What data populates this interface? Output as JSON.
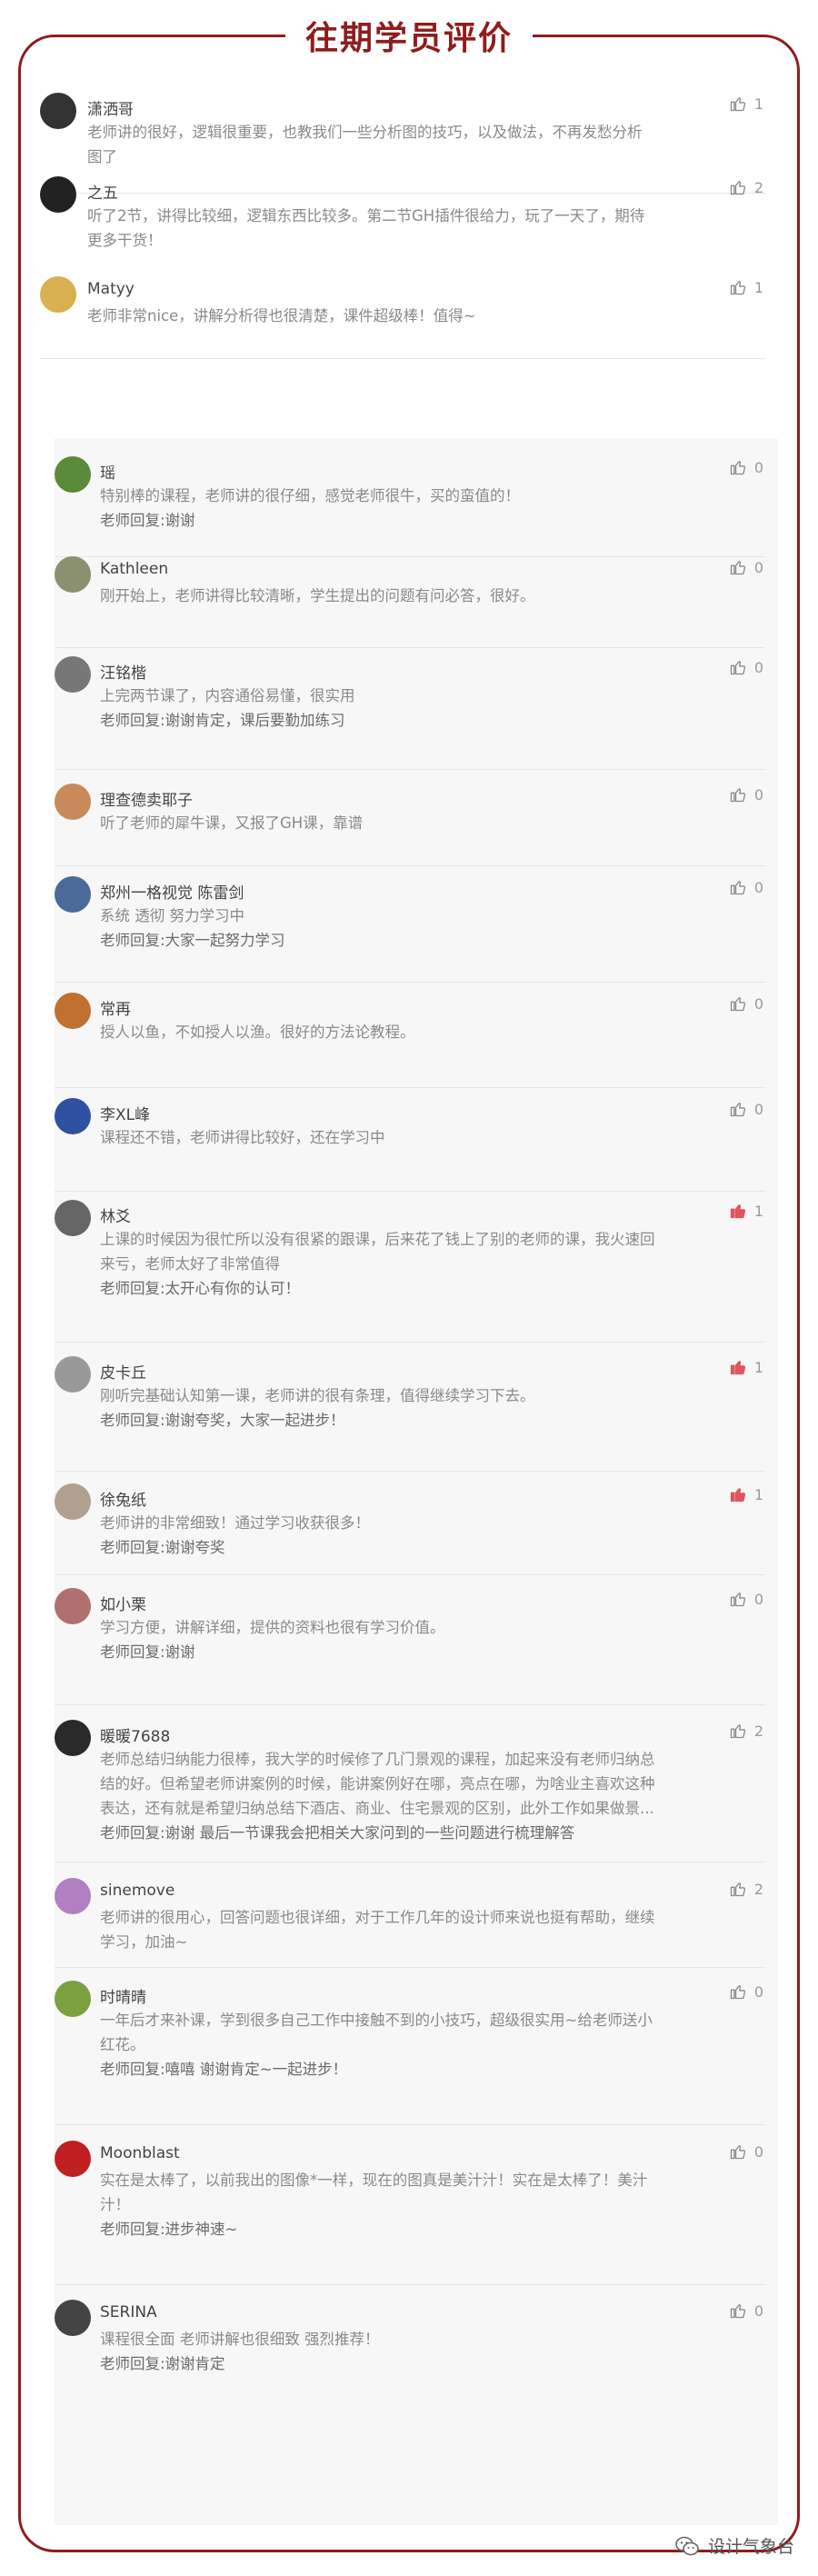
{
  "header": {
    "title": "往期学员评价"
  },
  "reviews": [
    {
      "name": "潇洒哥",
      "likes": "1",
      "comment": "老师讲的很好，逻辑很重要，也教我们一些分析图的技巧，以及做法，不再发愁分析\n图了",
      "reply": ""
    },
    {
      "name": "之五",
      "likes": "2",
      "comment": "听了2节，讲得比较细，逻辑东西比较多。第二节GH插件很给力，玩了一天了，期待\n更多干货！",
      "reply": ""
    },
    {
      "name": "Matyy",
      "likes": "1",
      "comment": "老师非常nice，讲解分析得也很清楚，课件超级棒！值得~",
      "reply": ""
    },
    {
      "name": "瑶",
      "likes": "0",
      "comment": "特别棒的课程，老师讲的很仔细，感觉老师很牛，买的蛮值的！",
      "reply": "老师回复:谢谢"
    },
    {
      "name": "Kathleen",
      "likes": "0",
      "comment": "刚开始上，老师讲得比较清晰，学生提出的问题有问必答，很好。",
      "reply": ""
    },
    {
      "name": "汪铭楷",
      "likes": "0",
      "comment": "上完两节课了，内容通俗易懂，很实用",
      "reply": "老师回复:谢谢肯定，课后要勤加练习"
    },
    {
      "name": "理查德卖耶子",
      "likes": "0",
      "comment": "听了老师的犀牛课，又报了GH课，靠谱",
      "reply": ""
    },
    {
      "name": "郑州一格视觉 陈雷剑",
      "likes": "0",
      "comment": "系统 透彻 努力学习中",
      "reply": "老师回复:大家一起努力学习"
    },
    {
      "name": "常再",
      "likes": "0",
      "comment": "授人以鱼，不如授人以渔。很好的方法论教程。",
      "reply": ""
    },
    {
      "name": "李XL峰",
      "likes": "0",
      "comment": "课程还不错，老师讲得比较好，还在学习中",
      "reply": ""
    },
    {
      "name": "林爻",
      "likes": "1",
      "comment": "上课的时候因为很忙所以没有很紧的跟课，后来花了钱上了别的老师的课，我火速回\n来亏，老师太好了非常值得",
      "reply": "老师回复:太开心有你的认可！"
    },
    {
      "name": "皮卡丘",
      "likes": "1",
      "comment": "刚听完基础认知第一课，老师讲的很有条理，值得继续学习下去。",
      "reply": "老师回复:谢谢夸奖，大家一起进步！"
    },
    {
      "name": "徐兔纸",
      "likes": "1",
      "comment": "老师讲的非常细致！通过学习收获很多！",
      "reply": "老师回复:谢谢夸奖"
    },
    {
      "name": "如小栗",
      "likes": "0",
      "comment": "学习方便，讲解详细，提供的资料也很有学习价值。",
      "reply": "老师回复:谢谢"
    },
    {
      "name": "暖暖7688",
      "likes": "2",
      "comment": "老师总结归纳能力很棒，我大学的时候修了几门景观的课程，加起来没有老师归纳总\n结的好。但希望老师讲案例的时候，能讲案例好在哪，亮点在哪，为啥业主喜欢这种\n表达，还有就是希望归纳总结下酒店、商业、住宅景观的区别，此外工作如果做景...",
      "reply": "老师回复:谢谢 最后一节课我会把相关大家问到的一些问题进行梳理解答"
    },
    {
      "name": "sinemove",
      "likes": "2",
      "comment": "老师讲的很用心，回答问题也很详细，对于工作几年的设计师来说也挺有帮助，继续\n学习，加油~",
      "reply": ""
    },
    {
      "name": "时晴晴",
      "likes": "0",
      "comment": "一年后才来补课，学到很多自己工作中接触不到的小技巧，超级很实用~给老师送小\n红花。",
      "reply": "老师回复:嘻嘻 谢谢肯定~一起进步！"
    },
    {
      "name": "Moonblast",
      "likes": "0",
      "comment": "实在是太棒了，以前我出的图像*一样，现在的图真是美汁汁！实在是太棒了！美汁\n汁！",
      "reply": "老师回复:进步神速~"
    },
    {
      "name": "SERINA",
      "likes": "0",
      "comment": "课程很全面 老师讲解也很细致 强烈推荐！",
      "reply": "老师回复:谢谢肯定"
    }
  ],
  "colors": {
    "accent": "#8e1d1d",
    "like_on": "#e05560",
    "panel_bg": "#f7f7f7"
  },
  "icons": {
    "like": "thumbs-up-icon",
    "watermark": "wechat-icon"
  },
  "watermark": {
    "label": "设计气象台"
  }
}
